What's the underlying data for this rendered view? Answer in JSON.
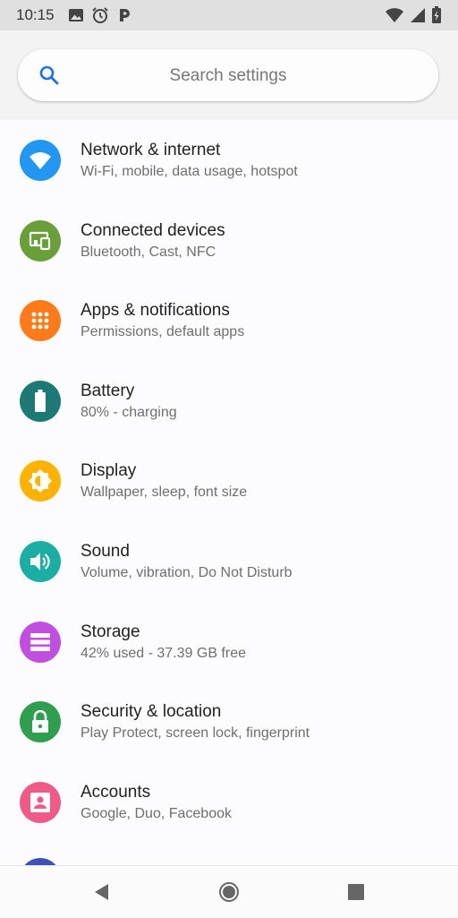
{
  "status_bar": {
    "time": "10:15",
    "left_icons": [
      "image-icon",
      "alarm-icon",
      "parking-icon"
    ],
    "right_icons": [
      "wifi-icon",
      "cell-signal-icon",
      "battery-charging-icon"
    ]
  },
  "search": {
    "placeholder": "Search settings",
    "icon": "search-icon"
  },
  "colors": {
    "accent": "#1a73e8",
    "network": "#2196f3",
    "connected": "#689f38",
    "apps": "#ff7b1a",
    "battery": "#1b7a73",
    "display": "#ffb300",
    "sound": "#1aaea5",
    "storage": "#c04fe0",
    "security": "#2e9e4f",
    "accounts": "#ef5a86"
  },
  "settings": [
    {
      "id": "network",
      "icon": "wifi-icon",
      "title": "Network & internet",
      "subtitle": "Wi-Fi, mobile, data usage, hotspot"
    },
    {
      "id": "connected",
      "icon": "devices-icon",
      "title": "Connected devices",
      "subtitle": "Bluetooth, Cast, NFC"
    },
    {
      "id": "apps",
      "icon": "apps-grid-icon",
      "title": "Apps & notifications",
      "subtitle": "Permissions, default apps"
    },
    {
      "id": "battery",
      "icon": "battery-icon",
      "title": "Battery",
      "subtitle": "80% - charging"
    },
    {
      "id": "display",
      "icon": "brightness-icon",
      "title": "Display",
      "subtitle": "Wallpaper, sleep, font size"
    },
    {
      "id": "sound",
      "icon": "volume-icon",
      "title": "Sound",
      "subtitle": "Volume, vibration, Do Not Disturb"
    },
    {
      "id": "storage",
      "icon": "storage-icon",
      "title": "Storage",
      "subtitle": "42% used - 37.39 GB free"
    },
    {
      "id": "security",
      "icon": "lock-icon",
      "title": "Security & location",
      "subtitle": "Play Protect, screen lock, fingerprint"
    },
    {
      "id": "accounts",
      "icon": "account-icon",
      "title": "Accounts",
      "subtitle": "Google, Duo, Facebook"
    }
  ],
  "nav_bar": {
    "buttons": [
      "back-icon",
      "home-icon",
      "recents-icon"
    ]
  }
}
